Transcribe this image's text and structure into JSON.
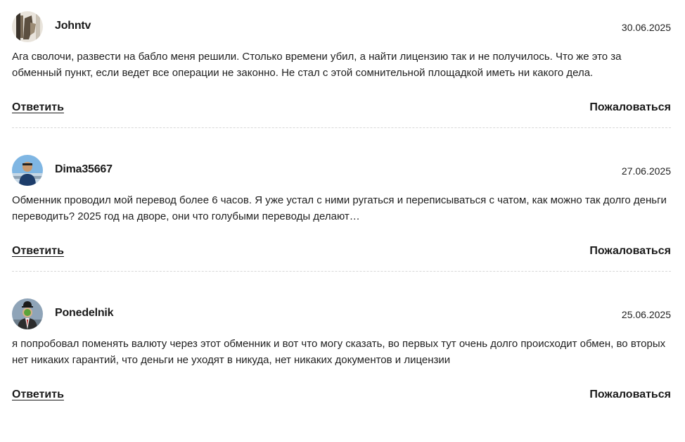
{
  "comments": [
    {
      "author": "Johntv",
      "avatar_icon": "user-photo-avatar-icon",
      "date": "30.06.2025",
      "text": "Ага сволочи, развести на бабло меня решили. Столько времени убил, а найти лицензию так и не получилось. Что же это за обменный пункт, если ведет все операции не законно. Не стал с этой сомнительной площадкой иметь ни какого дела.",
      "reply_label": "Ответить",
      "report_label": "Пожаловаться"
    },
    {
      "author": "Dima35667",
      "avatar_icon": "user-photo-avatar-icon",
      "date": "27.06.2025",
      "text": "Обменник проводил мой перевод более 6 часов. Я уже устал с ними ругаться и переписываться с чатом, как можно так долго деньги переводить? 2025 год на дворе, они что голубыми переводы делают…",
      "reply_label": "Ответить",
      "report_label": "Пожаловаться"
    },
    {
      "author": "Ponedelnik",
      "avatar_icon": "user-photo-avatar-icon",
      "date": "25.06.2025",
      "text": "я попробовал поменять валюту через этот обменник и вот что могу сказать, во первых тут очень долго происходит обмен, во вторых нет никаких гарантий, что деньги не уходят в никуда, нет никаких документов и лицензии",
      "reply_label": "Ответить",
      "report_label": "Пожаловаться"
    }
  ],
  "colors": {
    "text": "#1a1a1a",
    "divider": "#d8d8d8",
    "background": "#ffffff"
  }
}
